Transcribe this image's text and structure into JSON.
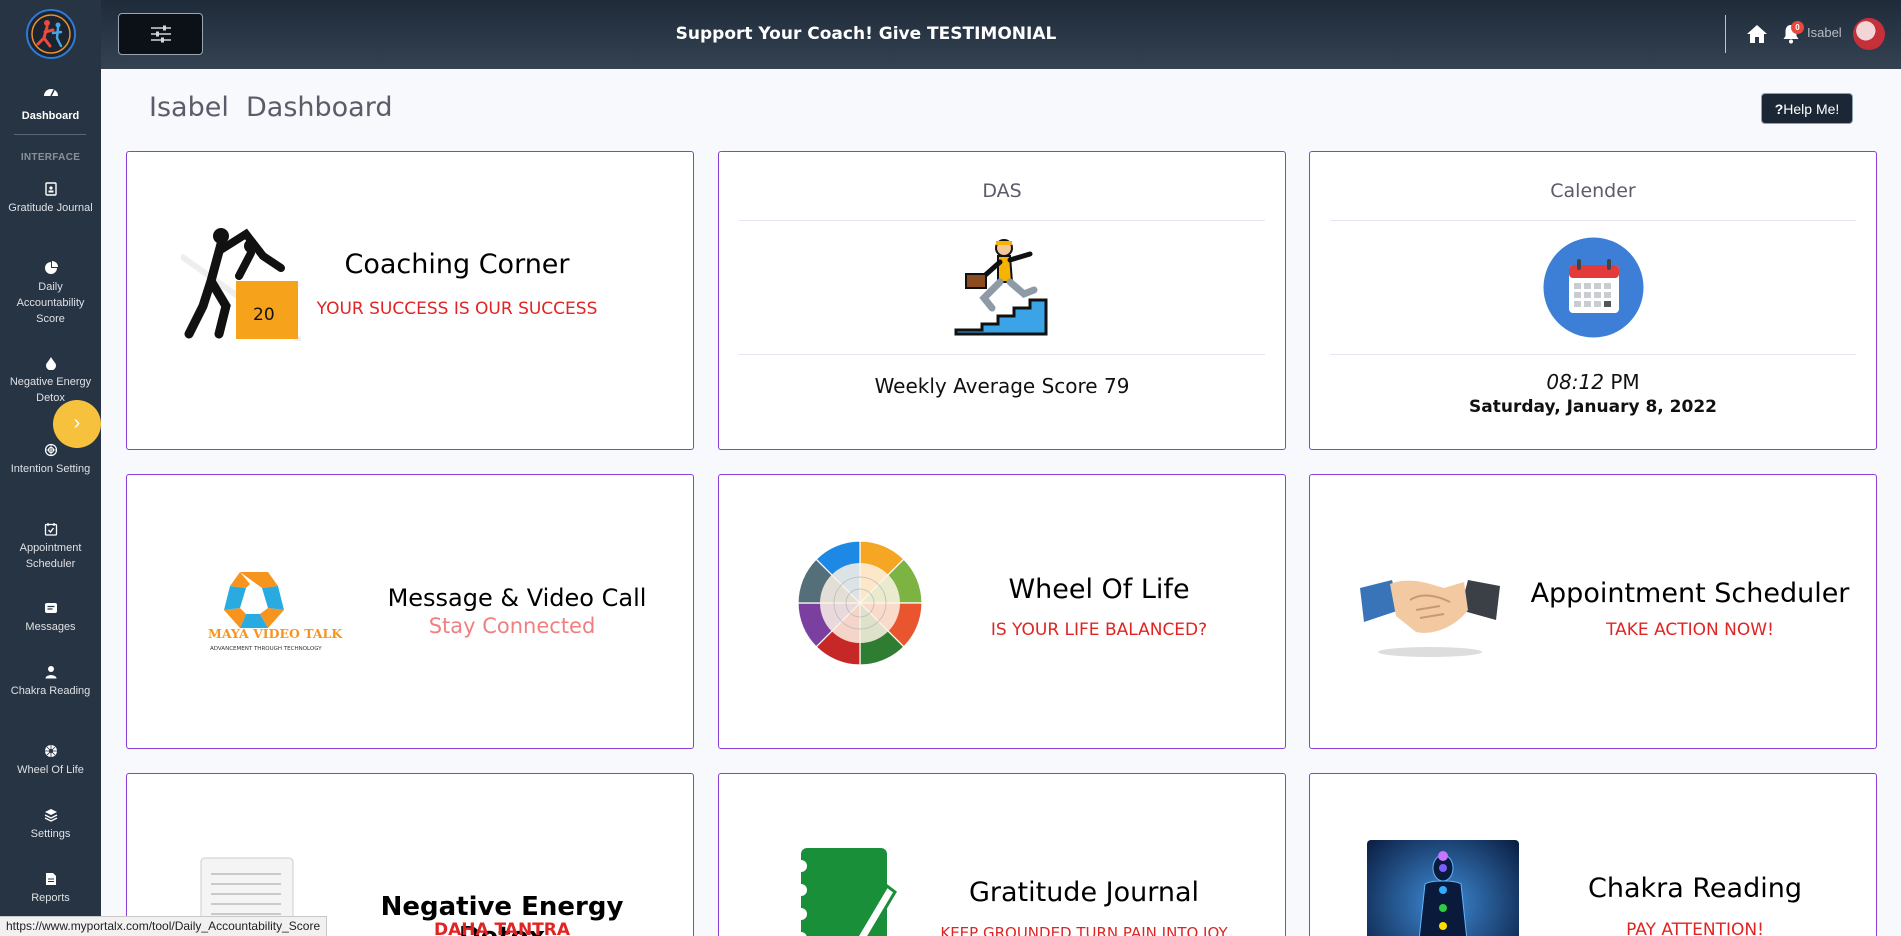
{
  "sidebar": {
    "dashboard_label": "Dashboard",
    "section_heading": "INTERFACE",
    "items": [
      {
        "label": "Gratitude Journal",
        "icon": "journal-icon"
      },
      {
        "label": "Daily Accountability Score",
        "icon": "pie-chart-icon"
      },
      {
        "label": "Negative Energy Detox",
        "icon": "drop-icon"
      },
      {
        "label": "Intention Setting",
        "icon": "target-icon"
      },
      {
        "label": "Appointment Scheduler",
        "icon": "calendar-check-icon"
      },
      {
        "label": "Messages",
        "icon": "message-icon"
      },
      {
        "label": "Chakra Reading",
        "icon": "user-icon"
      },
      {
        "label": "Wheel Of Life",
        "icon": "wheel-icon"
      },
      {
        "label": "Settings",
        "icon": "layers-icon"
      },
      {
        "label": "Reports",
        "icon": "report-icon"
      }
    ],
    "toggle_glyph": "›"
  },
  "topbar": {
    "message": "Support Your Coach! Give TESTIMONIAL",
    "notification_count": "0",
    "user_name": "Isabel"
  },
  "main": {
    "page_title": "Isabel  Dashboard",
    "help_label": "Help Me!"
  },
  "cards": {
    "coaching": {
      "title": "Coaching Corner",
      "subtitle": "YOUR SUCCESS IS OUR SUCCESS",
      "box_number": "20"
    },
    "das": {
      "header": "DAS",
      "score_text": "Weekly Average Score 79"
    },
    "calendar": {
      "header": "Calender",
      "time": "08:12",
      "ampm": "PM",
      "date": "Saturday, January 8, 2022"
    },
    "message": {
      "title": "Message & Video Call",
      "subtitle": "Stay Connected",
      "logo_text": "MAYA VIDEO TALK",
      "logo_tagline": "ADVANCEMENT THROUGH TECHNOLOGY"
    },
    "wheel": {
      "title": "Wheel Of Life",
      "subtitle": "IS YOUR LIFE BALANCED?"
    },
    "appointment": {
      "title": "Appointment Scheduler",
      "subtitle": "TAKE ACTION NOW!"
    },
    "detox": {
      "title": "Negative Energy Detox",
      "subtitle": "DAHA TANTRA"
    },
    "gratitude": {
      "title": "Gratitude Journal",
      "subtitle": "KEEP GROUNDED TURN PAIN INTO JOY"
    },
    "chakra": {
      "title": "Chakra Reading",
      "subtitle": "PAY ATTENTION!"
    }
  },
  "status_bar": {
    "url": "https://www.myportalx.com/tool/Daily_Accountability_Score"
  },
  "colors": {
    "sidebar_bg": "#273444",
    "card_border": "#8b3fd9",
    "subtitle_red": "#e02424",
    "toggle_yellow": "#f6c23e"
  }
}
